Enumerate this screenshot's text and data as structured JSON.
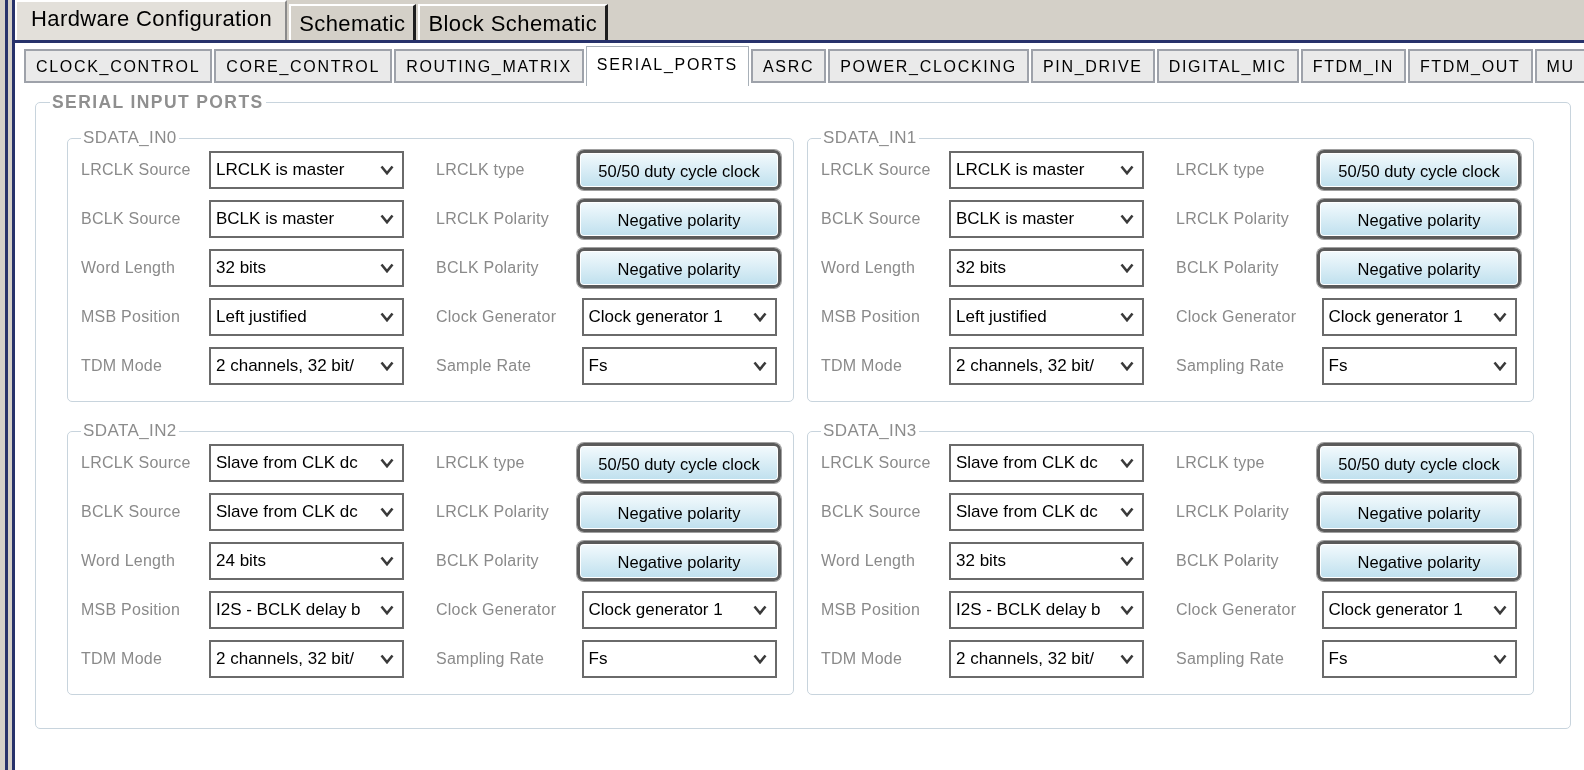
{
  "top_tabs": [
    {
      "label": "Hardware Configuration",
      "selected": true
    },
    {
      "label": "Schematic",
      "selected": false
    },
    {
      "label": "Block Schematic",
      "selected": false
    }
  ],
  "sub_tabs": [
    {
      "label": "CLOCK_CONTROL",
      "selected": false
    },
    {
      "label": "CORE_CONTROL",
      "selected": false
    },
    {
      "label": "ROUTING_MATRIX",
      "selected": false
    },
    {
      "label": "SERIAL_PORTS",
      "selected": true
    },
    {
      "label": "ASRC",
      "selected": false
    },
    {
      "label": "POWER_CLOCKING",
      "selected": false
    },
    {
      "label": "PIN_DRIVE",
      "selected": false
    },
    {
      "label": "DIGITAL_MIC",
      "selected": false
    },
    {
      "label": "FTDM_IN",
      "selected": false
    },
    {
      "label": "FTDM_OUT",
      "selected": false
    },
    {
      "label": "MU",
      "selected": false
    }
  ],
  "section": {
    "title": "SERIAL INPUT PORTS",
    "ports": [
      {
        "title": "SDATA_IN0",
        "fields": [
          {
            "label": "LRCLK Source",
            "kind": "dropdown",
            "value": "LRCLK is master"
          },
          {
            "label": "LRCLK type",
            "kind": "toggle",
            "value": "50/50 duty cycle clock"
          },
          {
            "label": "BCLK Source",
            "kind": "dropdown",
            "value": "BCLK is master"
          },
          {
            "label": "LRCLK Polarity",
            "kind": "toggle",
            "value": "Negative polarity"
          },
          {
            "label": "Word Length",
            "kind": "dropdown",
            "value": "32 bits"
          },
          {
            "label": "BCLK Polarity",
            "kind": "toggle",
            "value": "Negative polarity"
          },
          {
            "label": "MSB Position",
            "kind": "dropdown",
            "value": "Left justified"
          },
          {
            "label": "Clock Generator",
            "kind": "dropdown",
            "value": "Clock generator 1"
          },
          {
            "label": "TDM Mode",
            "kind": "dropdown",
            "value": "2 channels, 32 bit/"
          },
          {
            "label": "Sample Rate",
            "kind": "dropdown",
            "value": "Fs"
          }
        ]
      },
      {
        "title": "SDATA_IN1",
        "fields": [
          {
            "label": "LRCLK Source",
            "kind": "dropdown",
            "value": "LRCLK is master"
          },
          {
            "label": "LRCLK type",
            "kind": "toggle",
            "value": "50/50 duty cycle clock"
          },
          {
            "label": "BCLK Source",
            "kind": "dropdown",
            "value": "BCLK is master"
          },
          {
            "label": "LRCLK Polarity",
            "kind": "toggle",
            "value": "Negative polarity"
          },
          {
            "label": "Word Length",
            "kind": "dropdown",
            "value": "32 bits"
          },
          {
            "label": "BCLK Polarity",
            "kind": "toggle",
            "value": "Negative polarity"
          },
          {
            "label": "MSB Position",
            "kind": "dropdown",
            "value": "Left justified"
          },
          {
            "label": "Clock Generator",
            "kind": "dropdown",
            "value": "Clock generator 1"
          },
          {
            "label": "TDM Mode",
            "kind": "dropdown",
            "value": "2 channels, 32 bit/"
          },
          {
            "label": "Sampling Rate",
            "kind": "dropdown",
            "value": "Fs"
          }
        ]
      },
      {
        "title": "SDATA_IN2",
        "fields": [
          {
            "label": "LRCLK Source",
            "kind": "dropdown",
            "value": "Slave from CLK dc"
          },
          {
            "label": "LRCLK type",
            "kind": "toggle",
            "value": "50/50 duty cycle clock"
          },
          {
            "label": "BCLK Source",
            "kind": "dropdown",
            "value": "Slave from CLK dc"
          },
          {
            "label": "LRCLK Polarity",
            "kind": "toggle",
            "value": "Negative polarity"
          },
          {
            "label": "Word Length",
            "kind": "dropdown",
            "value": "24 bits"
          },
          {
            "label": "BCLK Polarity",
            "kind": "toggle",
            "value": "Negative polarity"
          },
          {
            "label": "MSB Position",
            "kind": "dropdown",
            "value": "I2S - BCLK delay b"
          },
          {
            "label": "Clock Generator",
            "kind": "dropdown",
            "value": "Clock generator 1"
          },
          {
            "label": "TDM Mode",
            "kind": "dropdown",
            "value": "2 channels, 32 bit/"
          },
          {
            "label": "Sampling Rate",
            "kind": "dropdown",
            "value": "Fs"
          }
        ]
      },
      {
        "title": "SDATA_IN3",
        "fields": [
          {
            "label": "LRCLK Source",
            "kind": "dropdown",
            "value": "Slave from CLK dc"
          },
          {
            "label": "LRCLK type",
            "kind": "toggle",
            "value": "50/50 duty cycle clock"
          },
          {
            "label": "BCLK Source",
            "kind": "dropdown",
            "value": "Slave from CLK dc"
          },
          {
            "label": "LRCLK Polarity",
            "kind": "toggle",
            "value": "Negative polarity"
          },
          {
            "label": "Word Length",
            "kind": "dropdown",
            "value": "32 bits"
          },
          {
            "label": "BCLK Polarity",
            "kind": "toggle",
            "value": "Negative polarity"
          },
          {
            "label": "MSB Position",
            "kind": "dropdown",
            "value": "I2S - BCLK delay b"
          },
          {
            "label": "Clock Generator",
            "kind": "dropdown",
            "value": "Clock generator 1"
          },
          {
            "label": "TDM Mode",
            "kind": "dropdown",
            "value": "2 channels, 32 bit/"
          },
          {
            "label": "Sampling Rate",
            "kind": "dropdown",
            "value": "Fs"
          }
        ]
      }
    ]
  }
}
